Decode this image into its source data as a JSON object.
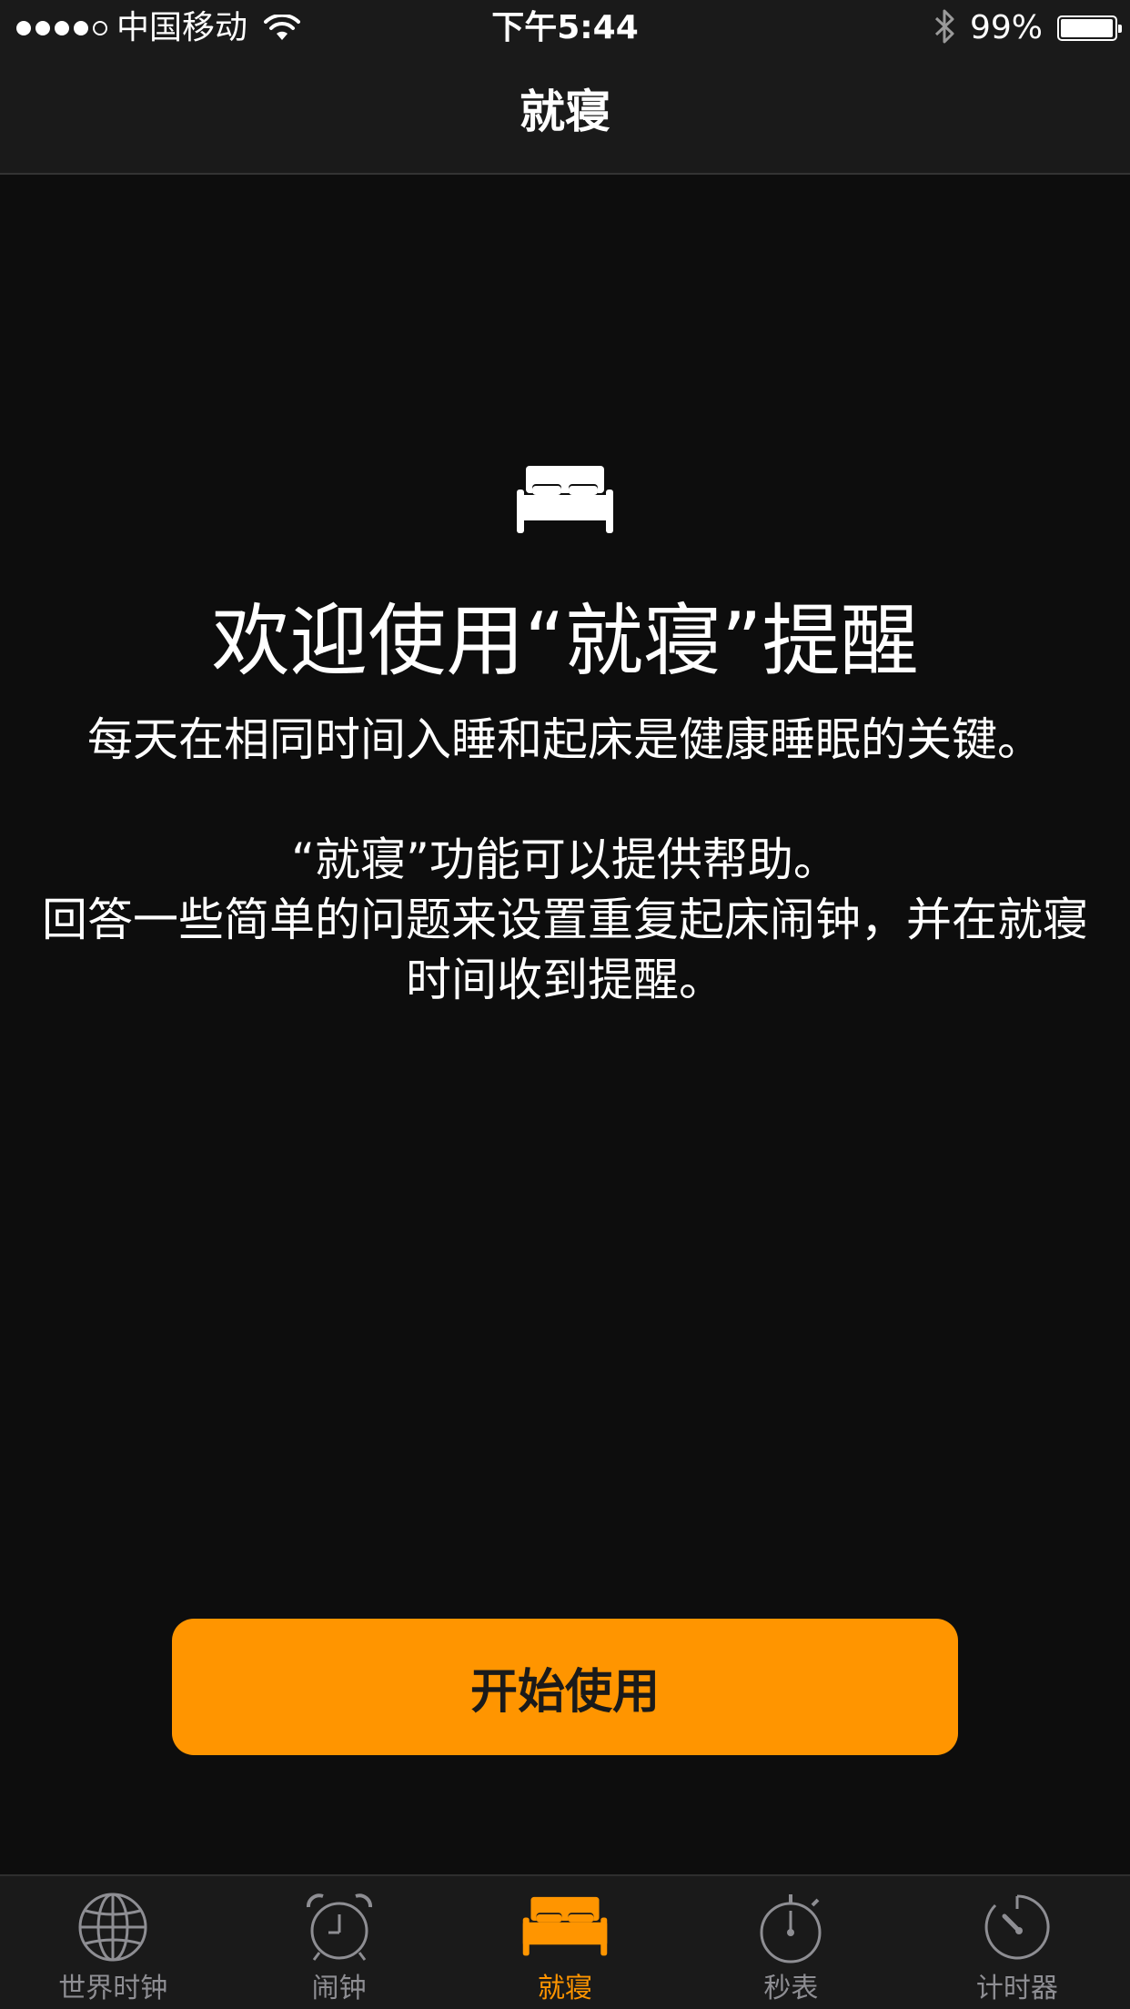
{
  "status_bar": {
    "carrier": "中国移动",
    "time": "下午5:44",
    "battery": "99%",
    "battery_level": 0.99,
    "signal_bars_filled": 4,
    "signal_bars_total": 5
  },
  "nav": {
    "title": "就寝"
  },
  "main": {
    "icon": "bed-icon",
    "title": "欢迎使用“就寝”提醒",
    "line1": "每天在相同时间入睡和起床是健康睡眠的关键。",
    "line2": "“就寝”功能可以提供帮助。",
    "line3": "回答一些简单的问题来设置重复起床闹钟，并在就寝时间收到提醒。",
    "button": "开始使用"
  },
  "tabs": [
    {
      "label": "世界时钟",
      "icon": "globe-icon",
      "active": false
    },
    {
      "label": "闹钟",
      "icon": "alarm-clock-icon",
      "active": false
    },
    {
      "label": "就寝",
      "icon": "bed-icon",
      "active": true
    },
    {
      "label": "秒表",
      "icon": "stopwatch-icon",
      "active": false
    },
    {
      "label": "计时器",
      "icon": "timer-icon",
      "active": false
    }
  ],
  "colors": {
    "accent": "#ff9500",
    "background": "#0d0d0d",
    "bar": "#1a1a1a",
    "inactive": "#8e8e93"
  }
}
